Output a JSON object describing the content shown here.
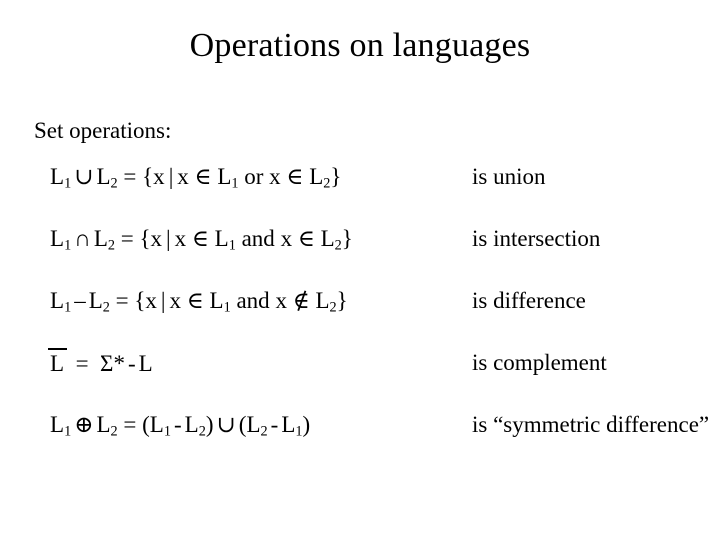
{
  "slide": {
    "title": "Operations on languages",
    "section_label": "Set operations:",
    "rows": [
      {
        "formula_plain": "L1 ∪ L2 = {x | x ∈ L1 or x ∈ L2}",
        "left_operand": "L",
        "left_sub": "1",
        "operator": "∪",
        "right_operand": "L",
        "right_sub": "2",
        "equals": "=",
        "set_open": "{x",
        "separator": "|",
        "cond_a": "x ∈ L",
        "cond_a_sub": "1",
        "connective": "or",
        "cond_b": "x ∈ L",
        "cond_b_sub": "2",
        "set_close": "}",
        "description": "is union"
      },
      {
        "formula_plain": "L1 ∩ L2 = {x | x ∈ L1 and x ∈ L2}",
        "left_operand": "L",
        "left_sub": "1",
        "operator": "∩",
        "right_operand": "L",
        "right_sub": "2",
        "equals": "=",
        "set_open": "{x",
        "separator": "|",
        "cond_a": "x ∈ L",
        "cond_a_sub": "1",
        "connective": "and",
        "cond_b": "x ∈ L",
        "cond_b_sub": "2",
        "set_close": "}",
        "description": "is intersection"
      },
      {
        "formula_plain": "L1 – L2 = {x | x ∈ L1 and x ∉ L2}",
        "left_operand": "L",
        "left_sub": "1",
        "operator": "–",
        "right_operand": "L",
        "right_sub": "2",
        "equals": "=",
        "set_open": "{x",
        "separator": "|",
        "cond_a": "x ∈ L",
        "cond_a_sub": "1",
        "connective": "and",
        "cond_b": "x ∉ L",
        "cond_b_sub": "2",
        "set_close": "}",
        "description": "is difference"
      },
      {
        "formula_plain": "L̅ = Σ* - L",
        "complement_operand": "L",
        "equals": "=",
        "sigma": "Σ",
        "star": "*",
        "minus": "-",
        "tail_operand": "L",
        "description": "is complement"
      },
      {
        "formula_plain": "L1 ⊕ L2 = (L1 - L2) ∪ (L2 - L1)",
        "left_operand": "L",
        "left_sub": "1",
        "operator": "⊕",
        "right_operand": "L",
        "right_sub": "2",
        "equals": "=",
        "group_a_open": "(L",
        "group_a_sub": "1",
        "group_minus": "-",
        "group_a_b": "L",
        "group_a_b_sub": "2",
        "group_a_close": ")",
        "union": "∪",
        "group_b_open": "(L",
        "group_b_sub": "2",
        "group_b_b": "L",
        "group_b_b_sub": "1",
        "group_b_close": ")",
        "description": "is “symmetric difference”"
      }
    ]
  },
  "colors": {
    "background": "#ffffff",
    "text": "#000000"
  }
}
